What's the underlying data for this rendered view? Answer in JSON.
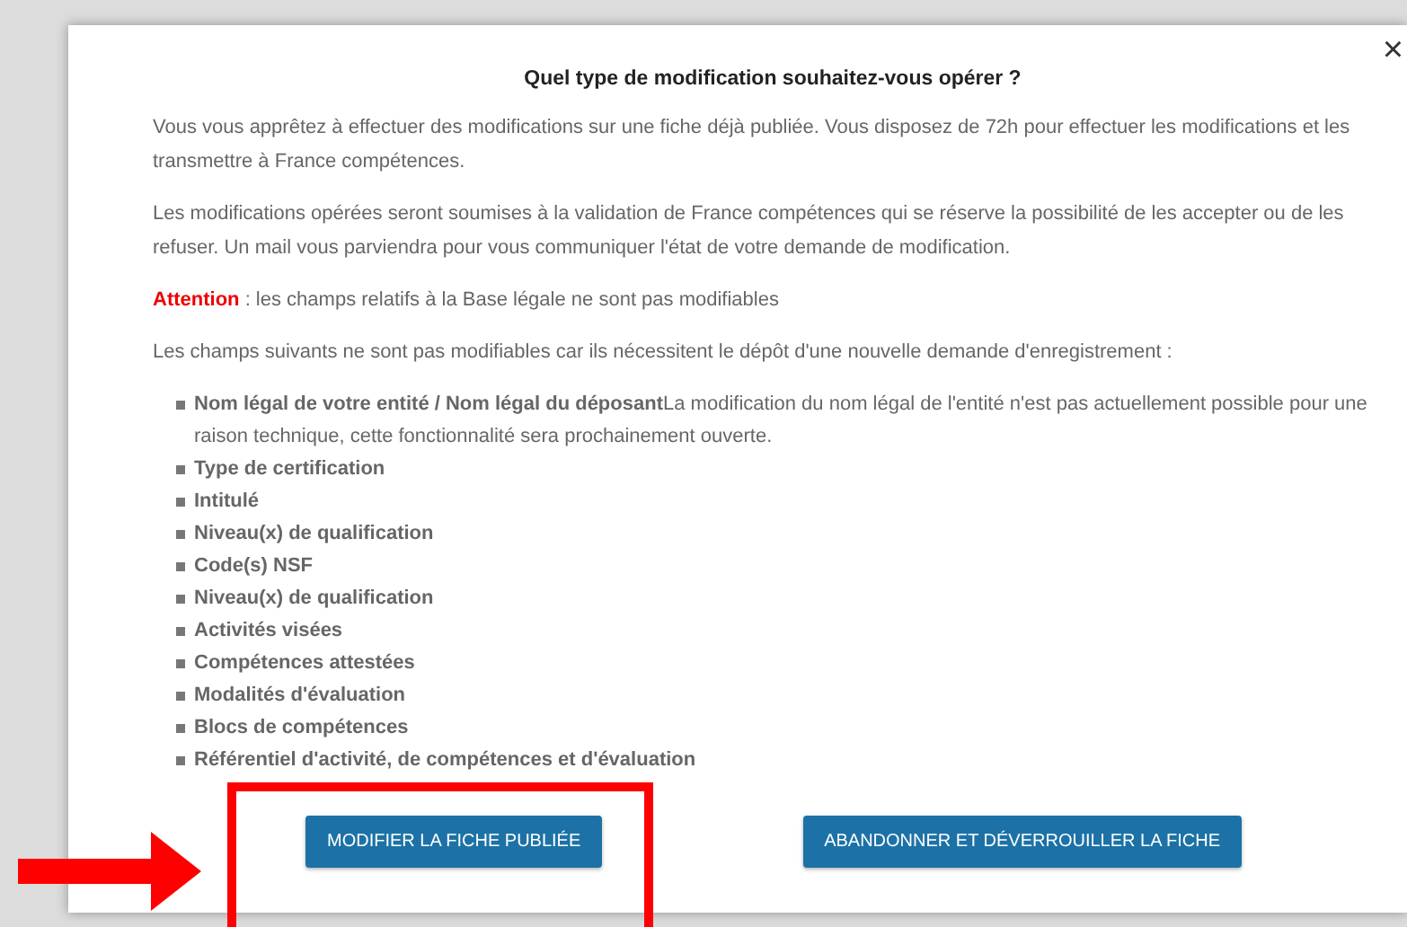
{
  "dialog": {
    "close": "×",
    "title": "Quel type de modification souhaitez-vous opérer ?",
    "paragraphs": [
      "Vous vous apprêtez à effectuer des modifications sur une fiche déjà publiée. Vous disposez de 72h pour effectuer les modifications et les transmettre à France compétences.",
      "Les modifications opérées seront soumises à la validation de France compétences qui se réserve la possibilité de les accepter ou de les refuser. Un mail vous parviendra pour vous communiquer l'état de votre demande de modification."
    ],
    "attention": {
      "label": "Attention",
      "text": " : les champs relatifs à la Base légale ne sont pas modifiables"
    },
    "intro": "Les champs suivants ne sont pas modifiables car ils nécessitent le dépôt d'une nouvelle demande d'enregistrement :",
    "fields": [
      {
        "text": "**Nom légal de votre entité / Nom légal du déposant**La modification du nom légal de l'entité n'est pas actuellement possible pour une raison technique, cette fonctionnalité sera prochainement ouverte."
      },
      {
        "text": "Type de certification"
      },
      {
        "text": "Intitulé"
      },
      {
        "text": "Niveau(x) de qualification"
      },
      {
        "text": "Code(s) NSF"
      },
      {
        "text": "Niveau(x) de qualification"
      },
      {
        "text": "Activités visées"
      },
      {
        "text": "Compétences attestées"
      },
      {
        "text": "Modalités d'évaluation"
      },
      {
        "text": "Blocs de compétences"
      },
      {
        "text": "Référentiel d'activité, de compétences et d'évaluation"
      }
    ],
    "buttons": [
      "MODIFIER LA FICHE PUBLIÉE",
      "ABANDONNER ET DÉVERROUILLER LA FICHE"
    ]
  }
}
